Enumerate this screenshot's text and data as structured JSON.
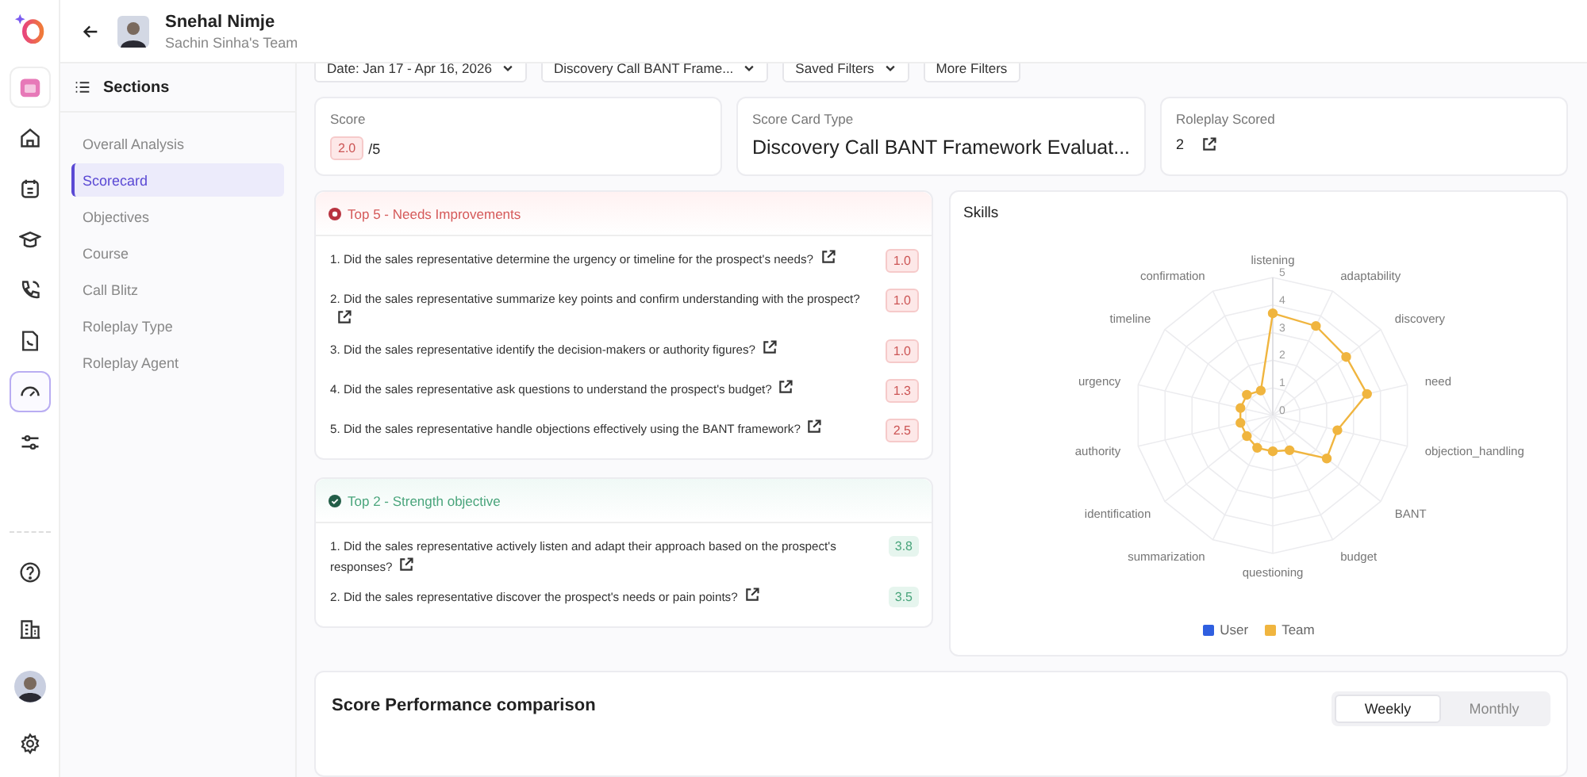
{
  "nav_icons": [
    {
      "kind": "app",
      "selected": false
    },
    {
      "kind": "home",
      "selected": false
    },
    {
      "kind": "calendar",
      "selected": false
    },
    {
      "kind": "cap",
      "selected": false
    },
    {
      "kind": "phone",
      "selected": false
    },
    {
      "kind": "document",
      "selected": false
    },
    {
      "kind": "gauge",
      "selected": true
    },
    {
      "kind": "sliders",
      "selected": false
    }
  ],
  "nav_bottom": [
    {
      "kind": "help"
    },
    {
      "kind": "building"
    },
    {
      "kind": "avatar"
    },
    {
      "kind": "settings"
    }
  ],
  "header": {
    "name": "Snehal Nimje",
    "team": "Sachin Sinha's Team"
  },
  "sections": {
    "title": "Sections",
    "items": [
      {
        "label": "Overall Analysis",
        "selected": false
      },
      {
        "label": "Scorecard",
        "selected": true
      },
      {
        "label": "Objectives",
        "selected": false
      },
      {
        "label": "Course",
        "selected": false
      },
      {
        "label": "Call Blitz",
        "selected": false
      },
      {
        "label": "Roleplay Type",
        "selected": false
      },
      {
        "label": "Roleplay Agent",
        "selected": false
      }
    ]
  },
  "filters": [
    {
      "label": "Date: Jan 17 - Apr 16, 2026",
      "dropdown": true
    },
    {
      "label": "Discovery Call BANT Frame...",
      "dropdown": true
    },
    {
      "label": "Saved Filters",
      "dropdown": true
    },
    {
      "label": "More Filters",
      "dropdown": false
    }
  ],
  "score": {
    "label": "Score",
    "value": "2.0",
    "out_of": "/5"
  },
  "score_card_type": {
    "label": "Score Card Type",
    "value": "Discovery Call BANT Framework Evaluat..."
  },
  "roleplay_scored": {
    "label": "Roleplay Scored",
    "value": "2"
  },
  "objective_groups": [
    {
      "kind": "weak",
      "title": "Top 5 - Needs Improvements",
      "items": [
        {
          "text": "1. Did the sales representative determine the urgency or timeline for the prospect's needs?",
          "score": "1.0"
        },
        {
          "text": "2. Did the sales representative summarize key points and confirm understanding with the prospect?",
          "score": "1.0"
        },
        {
          "text": "3. Did the sales representative identify the decision-makers or authority figures?",
          "score": "1.0"
        },
        {
          "text": "4. Did the sales representative ask questions to understand the prospect's budget?",
          "score": "1.3"
        },
        {
          "text": "5. Did the sales representative handle objections effectively using the BANT framework?",
          "score": "2.5"
        }
      ]
    },
    {
      "kind": "strong",
      "title": "Top 2 - Strength objective",
      "items": [
        {
          "text": "1. Did the sales representative actively listen and adapt their approach based on the prospect's responses?",
          "score": "3.8"
        },
        {
          "text": "2. Did the sales representative discover the prospect's needs or pain points?",
          "score": "3.5"
        }
      ]
    }
  ],
  "skills": {
    "title": "Skills",
    "legend": [
      {
        "name": "User",
        "color": "#2f5fe0"
      }
    ],
    "chart_data": {
      "type": "radar",
      "categories": [
        "listening",
        "adaptability",
        "discovery",
        "need",
        "objection_handling",
        "BANT",
        "budget",
        "questioning",
        "summarization",
        "identification",
        "authority",
        "urgency",
        "timeline",
        "confirmation"
      ],
      "ylim": [
        0,
        5
      ],
      "yticks": [
        0,
        1,
        2,
        3,
        4,
        5
      ],
      "series": [
        {
          "name": "Team",
          "color": "#f0b53f",
          "values": [
            3.7,
            3.6,
            3.4,
            3.5,
            2.4,
            2.5,
            1.4,
            1.3,
            1.3,
            1.2,
            1.2,
            1.2,
            1.2,
            1.0
          ]
        }
      ]
    }
  },
  "performance": {
    "title": "Score Performance comparison",
    "tabs": [
      {
        "label": "Weekly",
        "selected": true
      },
      {
        "label": "Monthly",
        "selected": false
      }
    ]
  }
}
